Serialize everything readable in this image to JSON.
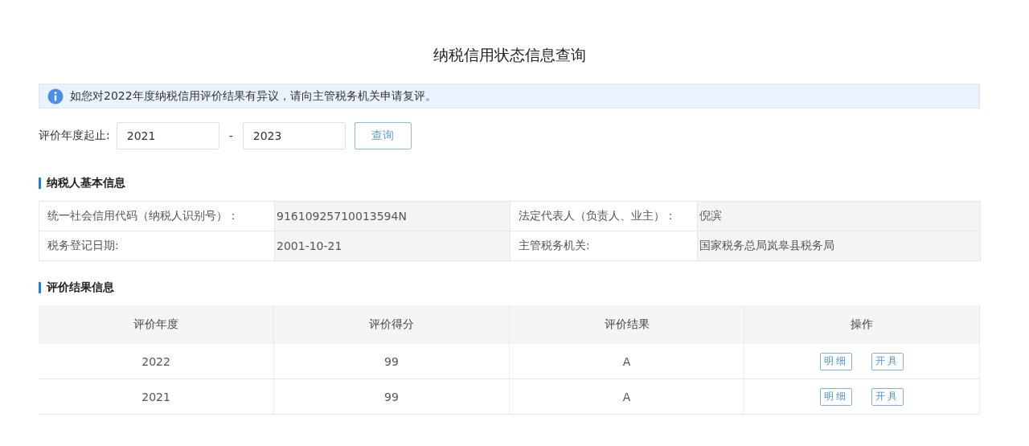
{
  "title": "纳税信用状态信息查询",
  "notice": "如您对2022年度纳税信用评价结果有异议，请向主管税务机关申请复评。",
  "filter": {
    "label": "评价年度起止:",
    "from": "2021",
    "separator": "-",
    "to": "2023",
    "button": "查询"
  },
  "basic_info": {
    "heading": "纳税人基本信息",
    "rows": [
      [
        "统一社会信用代码（纳税人识别号）：",
        "91610925710013594N",
        "法定代表人（负责人、业主）：",
        "倪滨"
      ],
      [
        "税务登记日期:",
        "2001-10-21",
        "主管税务机关:",
        "国家税务总局岚皋县税务局"
      ]
    ]
  },
  "results": {
    "heading": "评价结果信息",
    "columns": [
      "评价年度",
      "评价得分",
      "评价结果",
      "操作"
    ],
    "rows": [
      {
        "year": "2022",
        "score": "99",
        "grade": "A",
        "actions": [
          "明细",
          "开具"
        ]
      },
      {
        "year": "2021",
        "score": "99",
        "grade": "A",
        "actions": [
          "明细",
          "开具"
        ]
      }
    ]
  }
}
